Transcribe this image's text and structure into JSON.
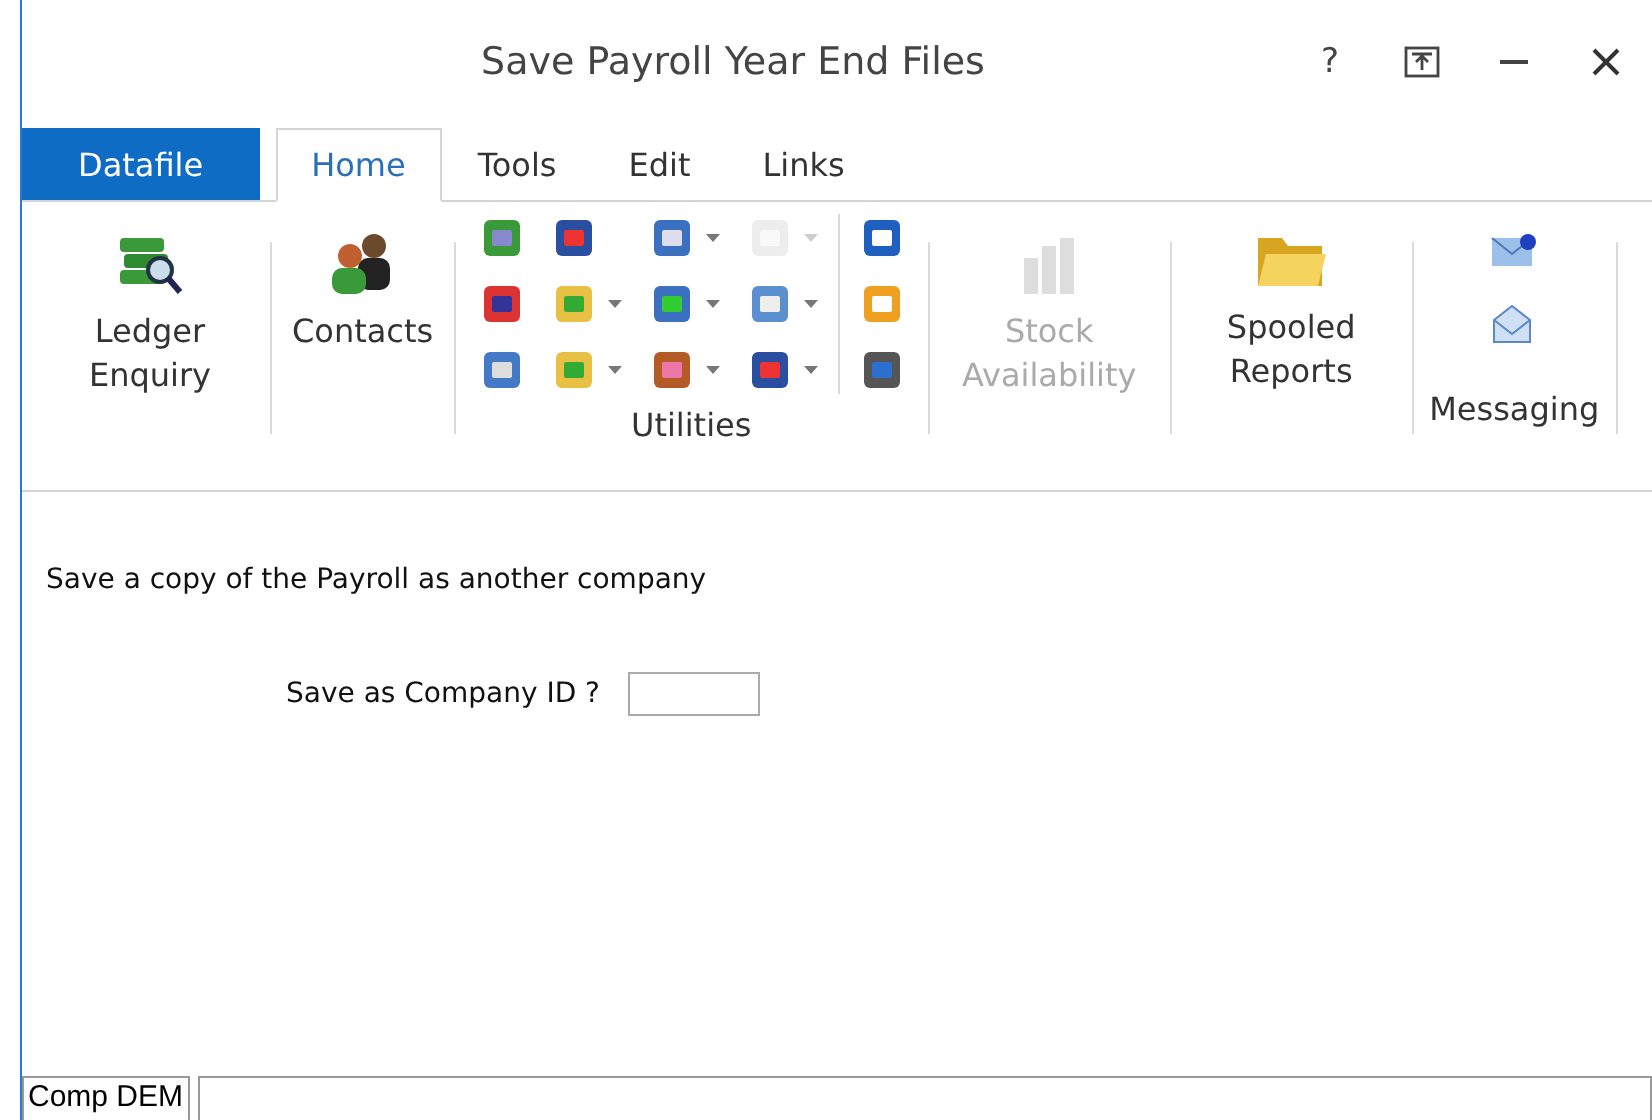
{
  "window": {
    "title": "Save Payroll Year End Files",
    "help": "?"
  },
  "tabs": [
    {
      "label": "Datafile",
      "kind": "file",
      "selected": false
    },
    {
      "label": "Home",
      "kind": "tab",
      "selected": true
    },
    {
      "label": "Tools",
      "kind": "tab",
      "selected": false
    },
    {
      "label": "Edit",
      "kind": "tab",
      "selected": false
    },
    {
      "label": "Links",
      "kind": "tab",
      "selected": false
    }
  ],
  "ribbon": {
    "large_left": [
      {
        "label": "Ledger Enquiry",
        "disabled": false
      },
      {
        "label": "Contacts",
        "disabled": false
      }
    ],
    "utilities": {
      "label": "Utilities",
      "columns": [
        [
          {
            "dropdown": false,
            "disabled": false
          },
          {
            "dropdown": false,
            "disabled": false
          },
          {
            "dropdown": false,
            "disabled": false
          }
        ],
        [
          {
            "dropdown": false,
            "disabled": false
          },
          {
            "dropdown": true,
            "disabled": false
          },
          {
            "dropdown": true,
            "disabled": false
          }
        ],
        [
          {
            "dropdown": true,
            "disabled": false
          },
          {
            "dropdown": true,
            "disabled": false
          },
          {
            "dropdown": true,
            "disabled": false
          }
        ],
        [
          {
            "dropdown": true,
            "disabled": true
          },
          {
            "dropdown": true,
            "disabled": false
          },
          {
            "dropdown": true,
            "disabled": false
          }
        ],
        [
          {
            "dropdown": false,
            "disabled": false
          },
          {
            "dropdown": false,
            "disabled": false
          },
          {
            "dropdown": false,
            "disabled": false
          }
        ]
      ]
    },
    "large_right": [
      {
        "label": "Stock Availability",
        "disabled": true
      },
      {
        "label": "Spooled Reports",
        "disabled": false
      }
    ],
    "messaging": {
      "label": "Messaging"
    }
  },
  "form": {
    "description": "Save a copy of the Payroll as another company",
    "field_label": "Save as Company ID ?"
  },
  "status_bar": {
    "company": "Comp DEM"
  }
}
